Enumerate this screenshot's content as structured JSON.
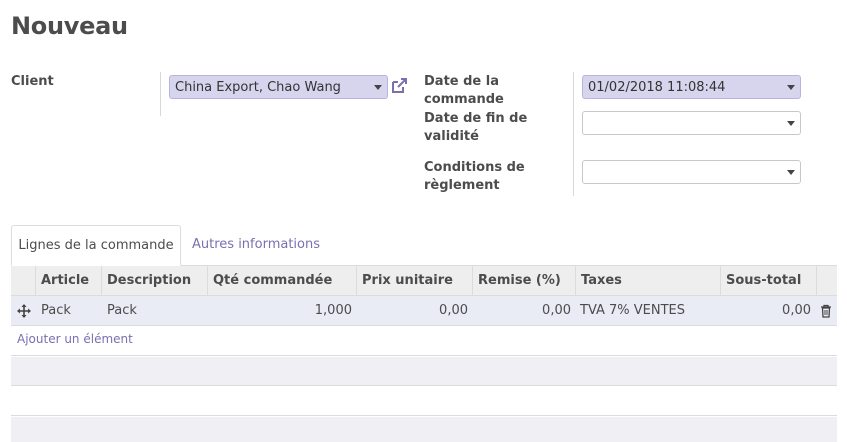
{
  "form": {
    "title": "Nouveau",
    "client_label": "Client",
    "client_value": "China Export, Chao Wang",
    "order_date_label_1": "Date de la",
    "order_date_label_2": "commande",
    "order_date_value": "01/02/2018 11:08:44",
    "validity_label_1": "Date de fin de",
    "validity_label_2": "validité",
    "validity_value": "",
    "payment_label_1": "Conditions de",
    "payment_label_2": "règlement",
    "payment_value": ""
  },
  "tabs": [
    {
      "label": "Lignes de la commande",
      "active": true
    },
    {
      "label": "Autres informations",
      "active": false
    }
  ],
  "table": {
    "headers": [
      "Article",
      "Description",
      "Qté commandée",
      "Prix unitaire",
      "Remise (%)",
      "Taxes",
      "Sous-total"
    ],
    "rows": [
      {
        "article": "Pack",
        "description": "Pack",
        "qty": "1,000",
        "unit_price": "0,00",
        "discount": "0,00",
        "taxes": "TVA 7% VENTES",
        "subtotal": "0,00"
      }
    ],
    "add_item_label": "Ajouter un élément"
  },
  "icons": {
    "drag_handle": "move-arrows-icon",
    "delete": "trash-icon",
    "external_link": "external-link-icon",
    "dropdown": "chevron-down-icon"
  },
  "colors": {
    "accent": "#7c6fb0",
    "field_filled": "#d7d4ee",
    "row_bg": "#e9ebf5",
    "header_bg": "#eeeeee",
    "stripe": "#f0f0f4"
  }
}
